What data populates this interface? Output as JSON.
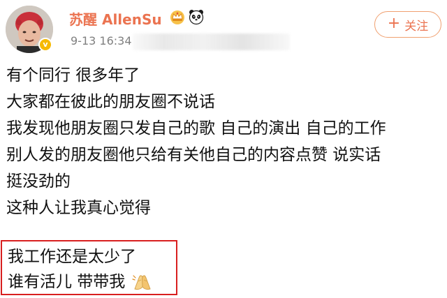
{
  "header": {
    "username": "苏醒 AllenSu",
    "post_time": "9-13 16:34",
    "follow_label": "关注",
    "plus_glyph": "+"
  },
  "icons": {
    "crown": "crown-icon",
    "panda": "panda-icon",
    "verified": "verified-badge-icon",
    "hands": "pressed-hands-emoji-icon"
  },
  "verified_glyph": "v",
  "post": {
    "lines": [
      "有个同行 很多年了",
      "大家都在彼此的朋友圈不说话",
      "我发现他朋友圈只发自己的歌 自己的演出 自己的工作",
      "别人发的朋友圈他只给有关他自己的内容点赞 说实话",
      "挺没劲的",
      "这种人让我真心觉得"
    ],
    "highlighted_lines": [
      "我工作还是太少了",
      "谁有活儿 带带我"
    ]
  },
  "colors": {
    "username": "#eb7350",
    "follow_border": "#f0a070",
    "highlight_border": "#d81f1f",
    "timestamp": "#808080",
    "verified": "#f6b900"
  }
}
